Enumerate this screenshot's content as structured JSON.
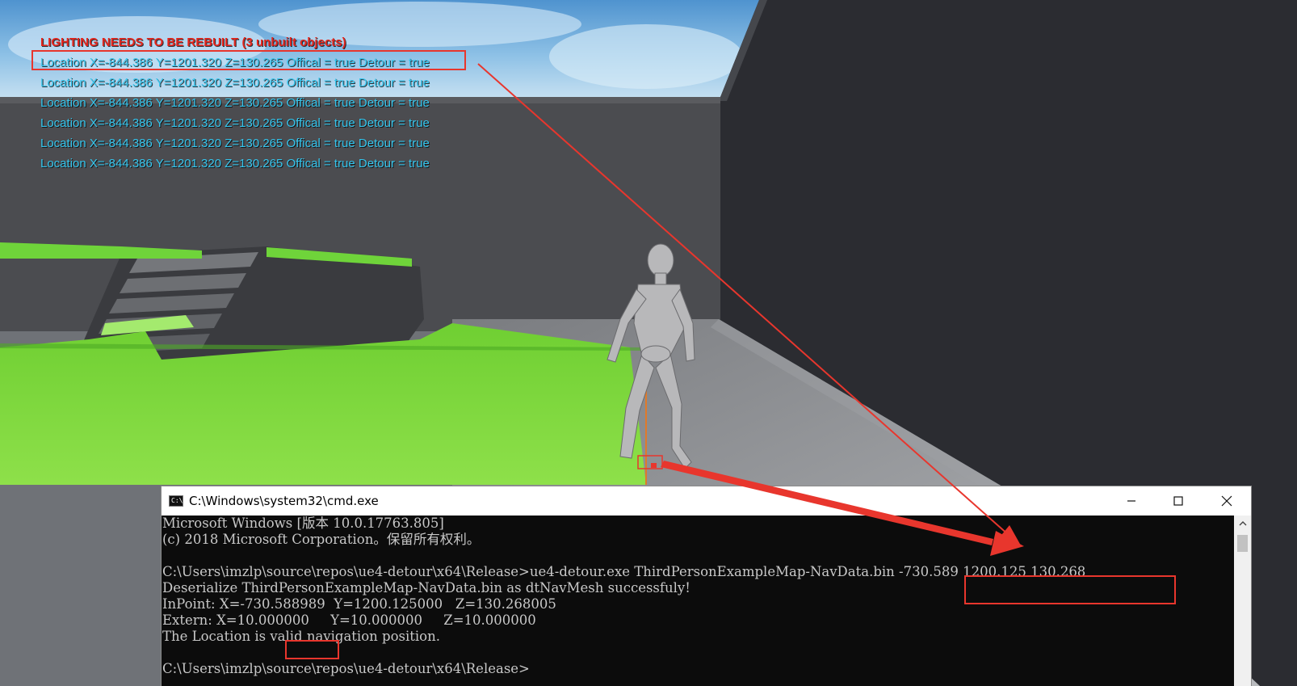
{
  "viewport": {
    "hud_warning": "LIGHTING NEEDS TO BE REBUILT (3 unbuilt objects)",
    "hud_lines": [
      "Location X=-844.386 Y=1201.320 Z=130.265 Offical = true Detour = true",
      "Location X=-844.386 Y=1201.320 Z=130.265 Offical = true Detour = true",
      "Location X=-844.386 Y=1201.320 Z=130.265 Offical = true Detour = true",
      "Location X=-844.386 Y=1201.320 Z=130.265 Offical = true Detour = true",
      "Location X=-844.386 Y=1201.320 Z=130.265 Offical = true Detour = true",
      "Location X=-844.386 Y=1201.320 Z=130.265 Offical = true Detour = true"
    ],
    "hud_warning_color": "#e4251c",
    "hud_text_color": "#35c6ee",
    "navmesh_color": "#7cd63a"
  },
  "cmd": {
    "title": "C:\\Windows\\system32\\cmd.exe",
    "icon": "console-icon",
    "lines": [
      "Microsoft Windows [版本 10.0.17763.805]",
      "(c) 2018 Microsoft Corporation。保留所有权利。",
      "",
      "C:\\Users\\imzlp\\source\\repos\\ue4-detour\\x64\\Release>ue4-detour.exe ThirdPersonExampleMap-NavData.bin -730.589 1200.125 130.268",
      "Deserialize ThirdPersonExampleMap-NavData.bin as dtNavMesh successfuly!",
      "InPoint: X=-730.588989  Y=1200.125000   Z=130.268005",
      "Extern: X=10.000000     Y=10.000000     Z=10.000000",
      "The Location is valid navigation position.",
      "",
      "C:\\Users\\imzlp\\source\\repos\\ue4-detour\\x64\\Release>"
    ]
  },
  "annotation_color": "#e8362d"
}
